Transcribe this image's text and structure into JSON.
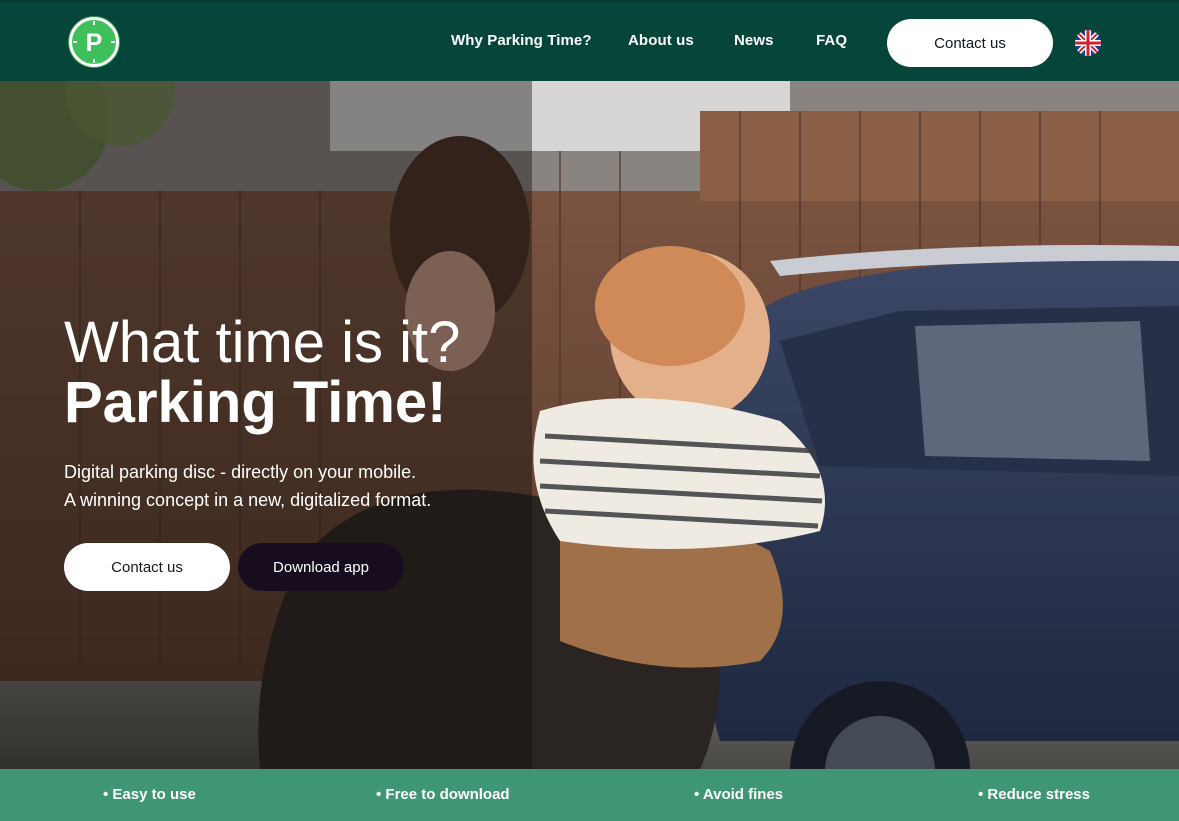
{
  "header": {
    "logo_letter": "P",
    "nav": {
      "why": "Why Parking Time?",
      "about": "About us",
      "news": "News",
      "faq": "FAQ"
    },
    "contact_label": "Contact us",
    "language_icon": "uk-flag-icon"
  },
  "hero": {
    "title_line1": "What time is it?",
    "title_line2": "Parking Time!",
    "subtitle_line1": "Digital parking disc - directly on your mobile.",
    "subtitle_line2": "A winning concept in a new, digitalized format.",
    "contact_label": "Contact us",
    "download_label": "Download app"
  },
  "features": [
    "• Easy to use",
    "• Free to download",
    "• Avoid fines",
    "• Reduce stress"
  ],
  "colors": {
    "header_bg": "#06453a",
    "accent_green": "#3fbf5a",
    "feature_bar": "#46a07d",
    "download_button": "#170d1e"
  }
}
